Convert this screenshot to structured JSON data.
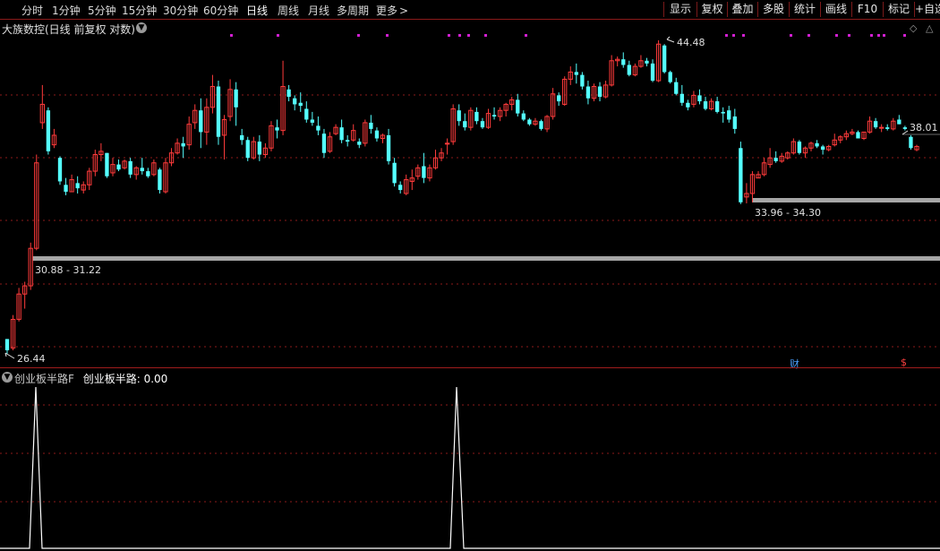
{
  "toolbar": {
    "tabs": [
      "分时",
      "1分钟",
      "5分钟",
      "15分钟",
      "30分钟",
      "60分钟",
      "日线",
      "周线",
      "月线",
      "多周期",
      "更多"
    ],
    "active_tab": "日线",
    "tools": [
      "显示",
      "复权",
      "叠加",
      "多股",
      "统计",
      "画线",
      "F10",
      "标记",
      "+自选"
    ]
  },
  "chart": {
    "stock_label": "大族数控(日线 前复权 对数)",
    "price_high_label": "44.48",
    "price_low_label": "26.44",
    "price_current_label": "38.01",
    "zone1_label": "30.88 - 31.22",
    "zone2_label": "33.96 - 34.30",
    "tag_cai": "财",
    "tag_dollar": "$",
    "colors": {
      "up": "#ff3b3b",
      "down": "#54ffff",
      "zone": "#a6a6a6",
      "grid": "#8b1a1a",
      "marker": "#d11fd1"
    }
  },
  "indicator": {
    "name": "创业板半路F",
    "value_label": "创业板半路: 0.00",
    "colors": {
      "name": "#c8c8c8",
      "value": "#ffffff",
      "line": "#ffffff"
    }
  },
  "chart_data": {
    "type": "candlestick",
    "x_axis": "trading days (oldest to newest)",
    "y_scale": "log",
    "ohlc": [
      [
        27.1,
        27.1,
        26.44,
        26.6
      ],
      [
        26.7,
        28.2,
        26.6,
        28.0
      ],
      [
        28.0,
        29.5,
        27.9,
        29.2
      ],
      [
        29.2,
        29.8,
        28.5,
        29.6
      ],
      [
        29.6,
        31.8,
        29.4,
        31.5
      ],
      [
        31.5,
        36.8,
        31.4,
        36.3
      ],
      [
        38.8,
        41.3,
        38.4,
        40.0
      ],
      [
        39.6,
        39.8,
        36.8,
        37.0
      ],
      [
        37.4,
        38.4,
        37.2,
        38.0
      ],
      [
        36.6,
        36.7,
        35.0,
        35.2
      ],
      [
        35.0,
        35.4,
        34.4,
        34.6
      ],
      [
        34.6,
        35.6,
        34.6,
        35.3
      ],
      [
        35.1,
        35.5,
        34.5,
        34.8
      ],
      [
        34.7,
        35.2,
        34.5,
        35.0
      ],
      [
        35.0,
        36.0,
        34.7,
        35.8
      ],
      [
        35.8,
        37.1,
        35.5,
        36.8
      ],
      [
        36.8,
        37.5,
        36.4,
        37.0
      ],
      [
        36.9,
        36.9,
        35.4,
        35.5
      ],
      [
        35.7,
        36.6,
        35.5,
        36.2
      ],
      [
        36.2,
        36.5,
        35.8,
        35.9
      ],
      [
        36.0,
        36.5,
        35.9,
        36.4
      ],
      [
        36.4,
        36.6,
        35.4,
        35.6
      ],
      [
        35.6,
        36.1,
        35.3,
        36.0
      ],
      [
        36.0,
        36.6,
        35.6,
        35.8
      ],
      [
        35.8,
        36.0,
        35.4,
        35.5
      ],
      [
        35.6,
        36.5,
        35.5,
        36.3
      ],
      [
        35.9,
        36.0,
        34.5,
        34.7
      ],
      [
        34.6,
        36.6,
        34.5,
        36.3
      ],
      [
        36.3,
        37.2,
        36.1,
        36.9
      ],
      [
        36.9,
        37.8,
        36.8,
        37.5
      ],
      [
        37.5,
        37.9,
        36.6,
        37.3
      ],
      [
        37.4,
        39.2,
        37.1,
        38.7
      ],
      [
        38.8,
        40.0,
        38.4,
        39.6
      ],
      [
        39.6,
        40.4,
        37.2,
        38.2
      ],
      [
        38.2,
        40.4,
        37.4,
        39.8
      ],
      [
        39.8,
        42.0,
        39.4,
        41.2
      ],
      [
        41.2,
        41.6,
        37.4,
        37.9
      ],
      [
        38.0,
        39.3,
        36.5,
        39.0
      ],
      [
        39.2,
        41.7,
        38.9,
        41.0
      ],
      [
        41.0,
        41.5,
        38.6,
        39.8
      ],
      [
        38.0,
        38.4,
        37.4,
        37.7
      ],
      [
        37.7,
        37.9,
        36.4,
        36.6
      ],
      [
        36.6,
        37.9,
        36.5,
        37.6
      ],
      [
        37.6,
        38.0,
        36.4,
        36.8
      ],
      [
        36.8,
        37.5,
        36.6,
        37.2
      ],
      [
        37.2,
        38.9,
        37.0,
        38.6
      ],
      [
        38.5,
        39.0,
        37.8,
        38.3
      ],
      [
        38.3,
        43.0,
        38.0,
        41.2
      ],
      [
        41.0,
        41.3,
        40.2,
        40.5
      ],
      [
        40.4,
        40.6,
        39.6,
        40.0
      ],
      [
        40.1,
        40.8,
        39.5,
        39.9
      ],
      [
        39.7,
        40.2,
        38.8,
        39.0
      ],
      [
        39.0,
        39.5,
        38.6,
        38.8
      ],
      [
        38.6,
        39.2,
        38.0,
        38.3
      ],
      [
        38.1,
        38.4,
        36.6,
        36.9
      ],
      [
        37.0,
        38.2,
        36.9,
        37.9
      ],
      [
        38.1,
        38.7,
        38.0,
        38.5
      ],
      [
        38.5,
        39.0,
        37.5,
        37.7
      ],
      [
        37.7,
        38.0,
        37.3,
        37.6
      ],
      [
        37.7,
        38.7,
        37.6,
        38.3
      ],
      [
        37.6,
        37.8,
        37.2,
        37.4
      ],
      [
        37.5,
        39.0,
        37.3,
        38.8
      ],
      [
        38.8,
        39.3,
        38.1,
        38.4
      ],
      [
        38.3,
        38.5,
        37.6,
        37.8
      ],
      [
        37.8,
        38.1,
        37.5,
        38.0
      ],
      [
        38.0,
        38.4,
        36.2,
        36.4
      ],
      [
        36.3,
        36.6,
        34.9,
        35.1
      ],
      [
        35.0,
        35.2,
        34.5,
        34.7
      ],
      [
        34.5,
        35.6,
        34.4,
        35.3
      ],
      [
        35.2,
        35.9,
        34.7,
        35.4
      ],
      [
        35.5,
        36.2,
        35.3,
        36.0
      ],
      [
        36.1,
        36.9,
        35.1,
        35.4
      ],
      [
        35.4,
        36.2,
        35.2,
        36.0
      ],
      [
        36.0,
        37.1,
        35.9,
        36.6
      ],
      [
        36.6,
        37.2,
        36.4,
        36.9
      ],
      [
        37.5,
        37.8,
        36.8,
        37.5
      ],
      [
        37.6,
        40.0,
        37.4,
        39.7
      ],
      [
        39.6,
        40.0,
        38.6,
        38.9
      ],
      [
        38.9,
        39.4,
        38.3,
        38.5
      ],
      [
        38.5,
        39.8,
        38.3,
        39.6
      ],
      [
        39.5,
        39.8,
        38.7,
        38.9
      ],
      [
        38.9,
        39.1,
        38.4,
        38.5
      ],
      [
        38.5,
        39.7,
        38.4,
        39.4
      ],
      [
        39.3,
        39.8,
        39.0,
        39.2
      ],
      [
        39.2,
        39.8,
        38.9,
        39.6
      ],
      [
        39.6,
        40.1,
        39.2,
        40.0
      ],
      [
        40.0,
        40.5,
        39.6,
        40.3
      ],
      [
        40.3,
        40.7,
        39.2,
        39.4
      ],
      [
        39.4,
        39.6,
        38.9,
        39.0
      ],
      [
        39.0,
        39.1,
        38.6,
        38.7
      ],
      [
        38.7,
        39.1,
        38.6,
        38.9
      ],
      [
        38.9,
        39.0,
        38.3,
        38.4
      ],
      [
        38.4,
        39.3,
        38.2,
        39.2
      ],
      [
        39.2,
        41.1,
        39.0,
        40.7
      ],
      [
        40.6,
        40.8,
        39.9,
        40.2
      ],
      [
        40.0,
        41.9,
        39.9,
        41.7
      ],
      [
        41.7,
        42.6,
        41.3,
        42.2
      ],
      [
        42.2,
        42.8,
        41.4,
        42.0
      ],
      [
        42.0,
        42.2,
        41.0,
        41.2
      ],
      [
        41.2,
        41.6,
        40.0,
        40.4
      ],
      [
        40.4,
        41.4,
        40.2,
        41.2
      ],
      [
        41.2,
        41.5,
        40.2,
        40.5
      ],
      [
        40.5,
        41.6,
        40.4,
        41.3
      ],
      [
        41.3,
        43.4,
        41.2,
        43.0
      ],
      [
        43.0,
        43.3,
        42.6,
        43.1
      ],
      [
        43.1,
        43.6,
        42.5,
        42.7
      ],
      [
        42.7,
        43.0,
        41.9,
        42.0
      ],
      [
        42.0,
        42.8,
        41.9,
        42.6
      ],
      [
        42.6,
        43.4,
        42.5,
        43.0
      ],
      [
        43.0,
        43.2,
        42.6,
        42.8
      ],
      [
        42.8,
        43.1,
        41.5,
        41.6
      ],
      [
        41.6,
        44.48,
        41.5,
        44.2
      ],
      [
        44.1,
        44.2,
        42.1,
        42.2
      ],
      [
        42.2,
        42.3,
        41.4,
        41.5
      ],
      [
        41.5,
        41.8,
        40.6,
        40.7
      ],
      [
        40.7,
        41.3,
        39.9,
        40.1
      ],
      [
        40.1,
        40.3,
        39.6,
        39.8
      ],
      [
        40.0,
        40.9,
        39.8,
        40.6
      ],
      [
        40.6,
        41.0,
        40.0,
        40.2
      ],
      [
        40.2,
        40.5,
        39.6,
        39.7
      ],
      [
        39.7,
        40.4,
        39.6,
        40.2
      ],
      [
        40.2,
        40.5,
        39.4,
        39.5
      ],
      [
        39.5,
        39.8,
        38.8,
        39.4
      ],
      [
        39.6,
        39.9,
        38.8,
        39.0
      ],
      [
        39.2,
        39.7,
        38.1,
        38.4
      ],
      [
        37.2,
        37.6,
        33.9,
        34.0
      ],
      [
        34.3,
        35.1,
        33.94,
        34.5
      ],
      [
        34.5,
        35.8,
        34.0,
        35.6
      ],
      [
        35.4,
        35.8,
        35.4,
        35.6
      ],
      [
        35.6,
        36.6,
        35.5,
        36.3
      ],
      [
        36.2,
        37.2,
        36.0,
        36.6
      ],
      [
        36.6,
        37.0,
        36.3,
        36.4
      ],
      [
        36.4,
        36.9,
        36.3,
        36.7
      ],
      [
        36.6,
        37.0,
        36.5,
        36.9
      ],
      [
        36.9,
        37.8,
        36.8,
        37.6
      ],
      [
        37.6,
        37.7,
        36.8,
        36.9
      ],
      [
        36.9,
        37.3,
        36.6,
        37.2
      ],
      [
        37.2,
        37.6,
        37.0,
        37.5
      ],
      [
        37.5,
        37.7,
        37.2,
        37.3
      ],
      [
        37.3,
        37.4,
        36.8,
        37.1
      ],
      [
        37.1,
        37.4,
        37.0,
        37.3
      ],
      [
        37.4,
        38.1,
        37.3,
        37.7
      ],
      [
        37.7,
        38.0,
        37.5,
        37.9
      ],
      [
        37.9,
        38.3,
        37.7,
        38.1
      ],
      [
        38.1,
        38.4,
        38.0,
        38.2
      ],
      [
        38.2,
        38.3,
        37.8,
        37.8
      ],
      [
        37.8,
        38.2,
        37.7,
        38.2
      ],
      [
        38.2,
        39.2,
        38.1,
        38.9
      ],
      [
        38.9,
        39.1,
        38.4,
        38.5
      ],
      [
        38.5,
        38.7,
        38.2,
        38.5
      ],
      [
        38.5,
        38.7,
        38.3,
        38.4
      ],
      [
        38.4,
        39.1,
        38.3,
        38.9
      ],
      [
        39.0,
        39.3,
        38.7,
        38.7
      ],
      [
        38.5,
        38.6,
        38.3,
        38.4
      ],
      [
        37.9,
        38.0,
        37.1,
        37.2
      ],
      [
        37.1,
        37.4,
        37.0,
        37.3
      ]
    ],
    "support_zones": [
      [
        30.88,
        31.22
      ],
      [
        33.96,
        34.3
      ]
    ],
    "indicator_name": "创业板半路",
    "indicator_value": 0.0
  }
}
